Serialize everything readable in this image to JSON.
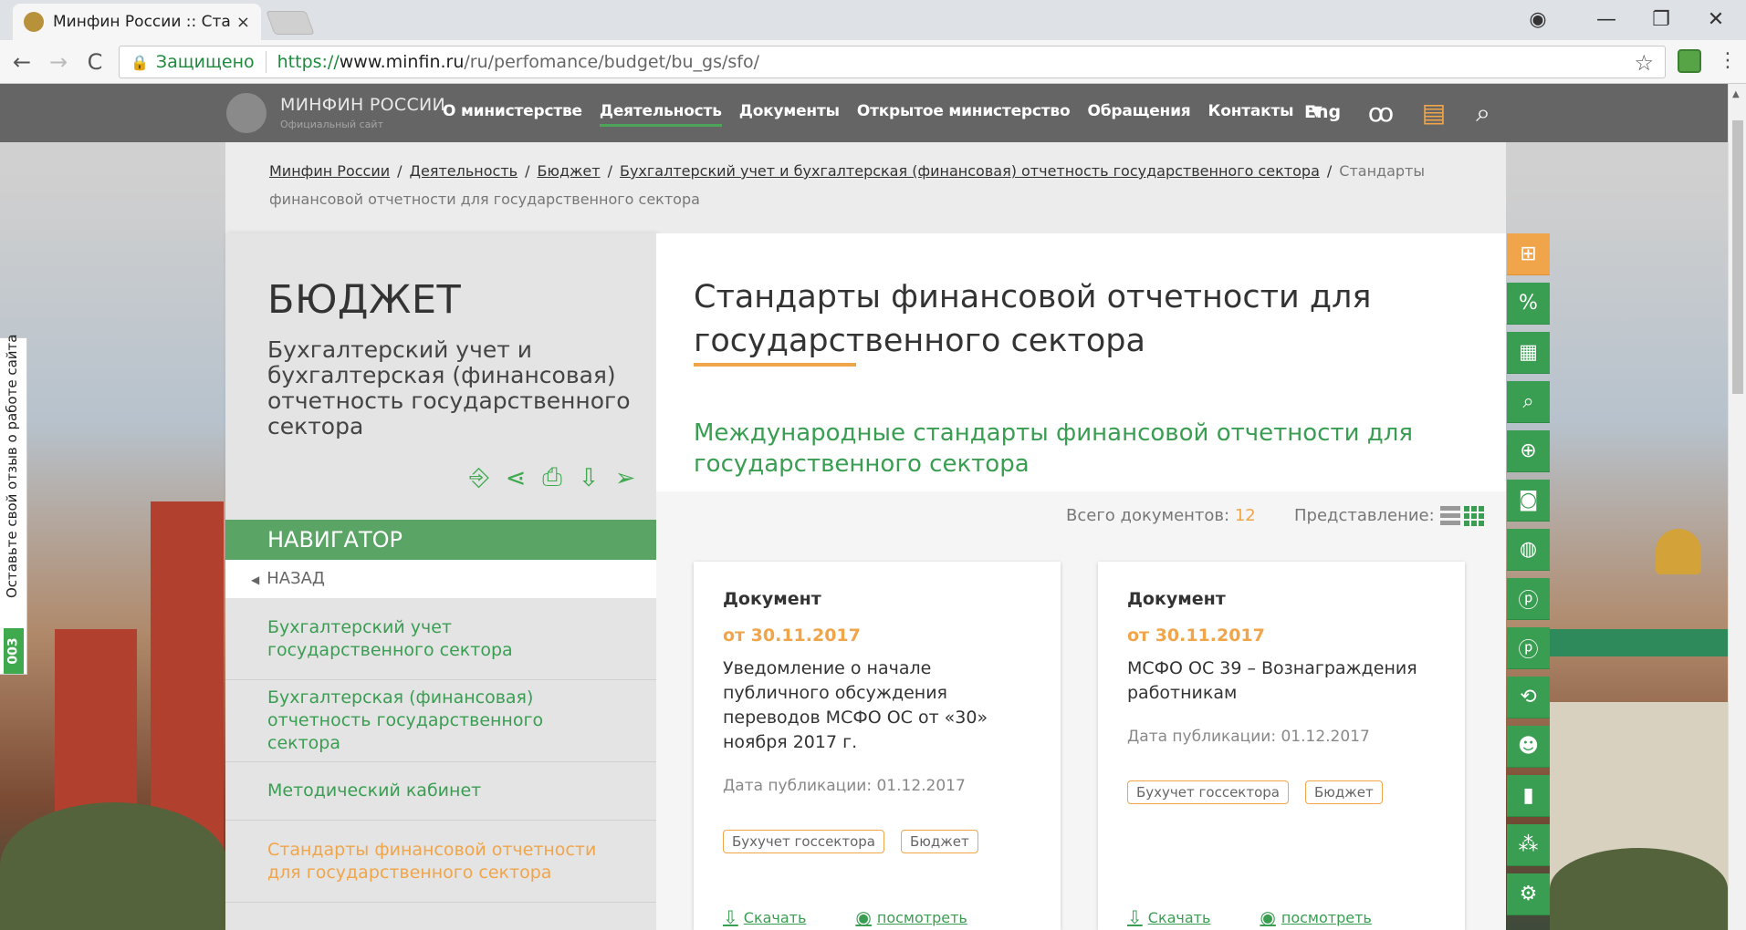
{
  "browser": {
    "tab_title": "Минфин России :: Станд",
    "tab_close": "×",
    "secure_label": "Защищено",
    "url_scheme": "https://",
    "url_host": "www.minfin.ru",
    "url_path": "/ru/perfomance/budget/bu_gs/sfo/",
    "icons": {
      "back": "←",
      "forward": "→",
      "reload": "C",
      "lock": "🔒",
      "star": "☆",
      "menu": "⋮",
      "profile": "◉",
      "minimize": "—",
      "restore": "❐",
      "close": "✕"
    }
  },
  "site": {
    "brand": "МИНФИН РОССИИ",
    "brand_sub": "Официальный сайт",
    "menu": [
      "О министерстве",
      "Деятельность",
      "Документы",
      "Открытое министерство",
      "Обращения",
      "Контакты"
    ],
    "menu_active_index": 1,
    "menu_caret": "▼",
    "lang": "Eng",
    "icons": {
      "glasses": "ꝏ",
      "doc": "▤",
      "search": "⌕"
    }
  },
  "feedback": {
    "text": "Оставьте свой отзыв о работе сайта",
    "badge": "003"
  },
  "breadcrumbs": {
    "items": [
      "Минфин России",
      "Деятельность",
      "Бюджет",
      "Бухгалтерский учет и бухгалтерская (финансовая) отчетность государственного сектора"
    ],
    "current": "Стандарты финансовой отчетности для государственного сектора",
    "separator": "/"
  },
  "sidebar": {
    "title": "БЮДЖЕТ",
    "subtitle": "Бухгалтерский учет и бухгалтерская (финансовая) отчетность государственного сектора",
    "tool_icons": [
      "⎆",
      "⋖",
      "⎙",
      "⇩",
      "➢"
    ],
    "navigator_label": "НАВИГАТОР",
    "back_label": "НАЗАД",
    "items": [
      "Бухгалтерский учет государственного сектора",
      "Бухгалтерская (финансовая) отчетность государственного сектора",
      "Методический кабинет",
      "Стандарты финансовой отчетности для государственного сектора"
    ],
    "current_index": 3
  },
  "main": {
    "title": "Стандарты финансовой отчетности для государственного сектора",
    "section_title": "Международные стандарты финансовой отчетности для государственного сектора",
    "total_label": "Всего документов:",
    "total_count": "12",
    "view_label": "Представление:",
    "cards": [
      {
        "type": "Документ",
        "date": "от 30.11.2017",
        "title": "Уведомление о начале публичного обсуждения переводов МСФО ОС от «30» ноября 2017 г.",
        "published": "Дата публикации: 01.12.2017",
        "tags": [
          "Бухучет госсектора",
          "Бюджет"
        ],
        "download": "Скачать",
        "view": "посмотреть"
      },
      {
        "type": "Документ",
        "date": "от 30.11.2017",
        "title": "МСФО ОС 39 – Вознаграждения работникам",
        "published": "Дата публикации: 01.12.2017",
        "tags": [
          "Бухучет госсектора",
          "Бюджет"
        ],
        "download": "Скачать",
        "view": "посмотреть"
      }
    ]
  },
  "right_strip": {
    "icons": [
      "briefcase-icon",
      "percent-icon",
      "calculator-icon",
      "report-search-icon",
      "globe-ruble-icon",
      "ruble-note-icon",
      "money-bag-icon",
      "ruble-coin-icon",
      "ruble-circle-icon",
      "exchange-icon",
      "people-icon",
      "bar-chart-icon",
      "network-icon",
      "settings-doc-icon"
    ],
    "glyphs": [
      "⊞",
      "%",
      "▦",
      "⌕",
      "⊕",
      "◙",
      "◍",
      "ⓟ",
      "ⓟ",
      "⟲",
      "☻",
      "▮",
      "⁂",
      "⚙"
    ]
  },
  "colors": {
    "green": "#3a9e52",
    "orange": "#f0a54a",
    "nav_bg": "#656565"
  }
}
